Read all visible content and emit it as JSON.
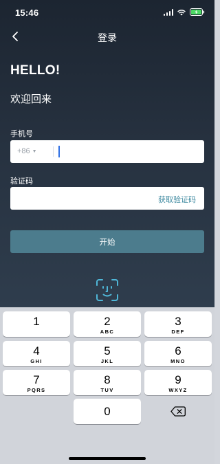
{
  "status": {
    "time": "15:46"
  },
  "nav": {
    "title": "登录"
  },
  "greeting": {
    "hello": "HELLO!",
    "welcome": "欢迎回来"
  },
  "phone": {
    "label": "手机号",
    "country_code": "+86",
    "value": ""
  },
  "code": {
    "label": "验证码",
    "get_code": "获取验证码",
    "value": ""
  },
  "actions": {
    "start_label": "开始"
  },
  "keyboard": {
    "keys": [
      {
        "num": "1",
        "letters": ""
      },
      {
        "num": "2",
        "letters": "ABC"
      },
      {
        "num": "3",
        "letters": "DEF"
      },
      {
        "num": "4",
        "letters": "GHI"
      },
      {
        "num": "5",
        "letters": "JKL"
      },
      {
        "num": "6",
        "letters": "MNO"
      },
      {
        "num": "7",
        "letters": "PQRS"
      },
      {
        "num": "8",
        "letters": "TUV"
      },
      {
        "num": "9",
        "letters": "WXYZ"
      },
      {
        "num": "0",
        "letters": ""
      }
    ],
    "delete_icon": "backspace-icon"
  },
  "colors": {
    "background_top": "#1c2531",
    "background_bottom": "#2f3d4d",
    "accent": "#4c7c8d",
    "link": "#3f8aa0",
    "cursor": "#2f6fe4",
    "face_id": "#4fb7d8"
  }
}
